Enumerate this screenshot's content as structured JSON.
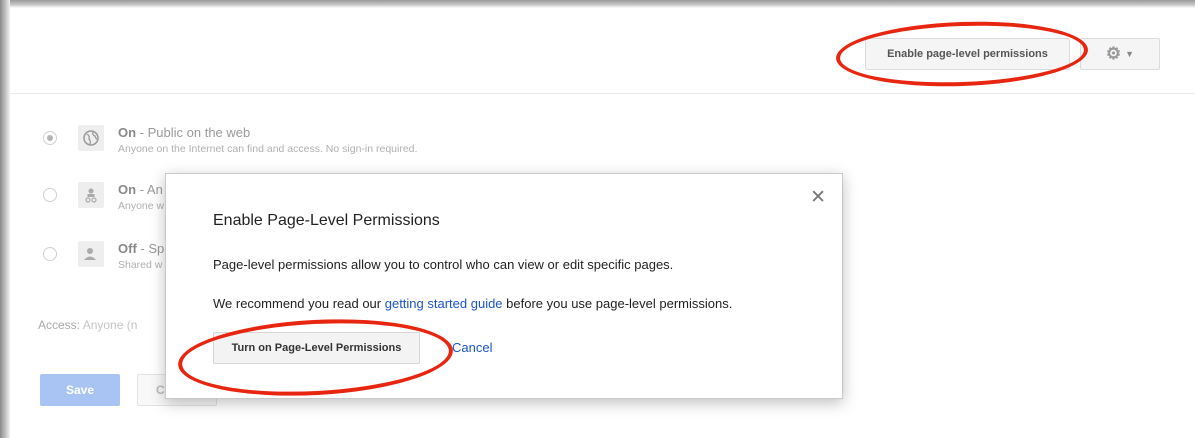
{
  "header": {
    "enable_button": "Enable page-level permissions",
    "gear_icon": "gear-icon"
  },
  "visibility": {
    "options": [
      {
        "state": "On",
        "title_rest": " - Public on the web",
        "desc": "Anyone on the Internet can find and access. No sign-in required.",
        "icon": "globe-icon",
        "selected": true
      },
      {
        "state": "On",
        "title_rest": " - An",
        "desc": "Anyone w",
        "icon": "anonymous-user-icon",
        "selected": false
      },
      {
        "state": "Off",
        "title_rest": " - Sp",
        "desc": "Shared w",
        "icon": "person-icon",
        "selected": false
      }
    ]
  },
  "access": {
    "label": "Access:",
    "value": "Anyone (n"
  },
  "footer": {
    "save_label": "Save",
    "cancel_label": "C"
  },
  "dialog": {
    "title": "Enable Page-Level Permissions",
    "paragraph1": "Page-level permissions allow you to control who can view or edit specific pages.",
    "paragraph2_before": "We recommend you read our ",
    "paragraph2_link": "getting started guide",
    "paragraph2_after": " before you use page-level permissions.",
    "turn_on_label": "Turn on Page-Level Permissions",
    "cancel_label": "Cancel",
    "close_icon": "close-icon"
  },
  "colors": {
    "annotation": "#e8250f",
    "link": "#1a55c9",
    "save_button": "#a9c4f2"
  }
}
